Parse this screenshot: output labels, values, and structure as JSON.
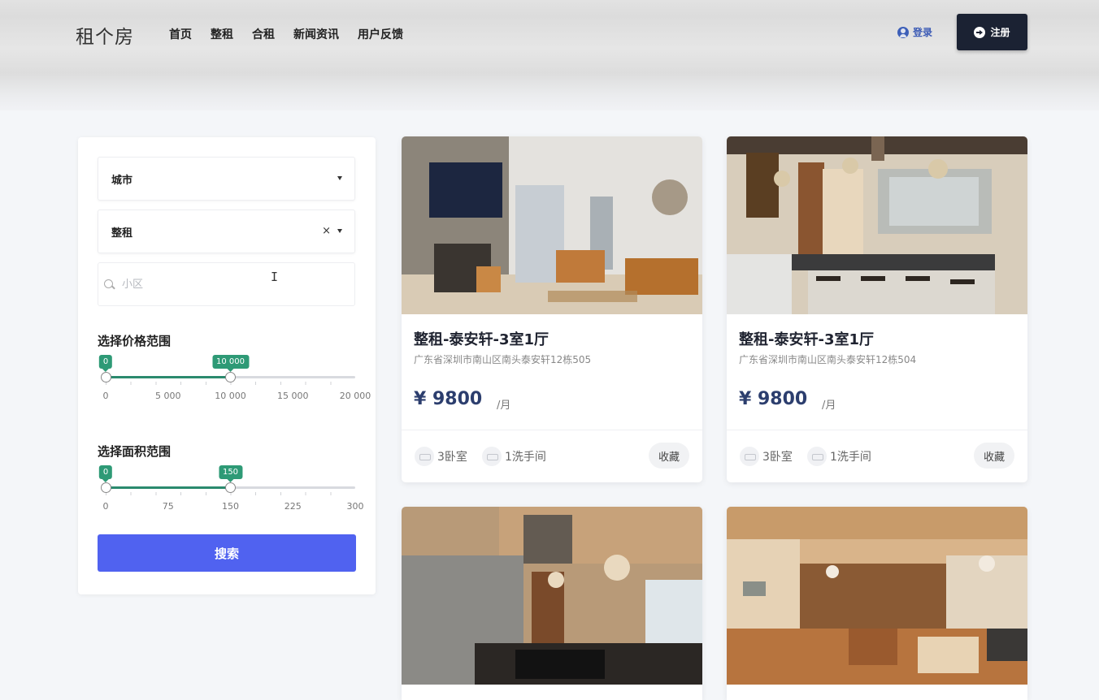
{
  "header": {
    "brand": "租个房",
    "nav": [
      "首页",
      "整租",
      "合租",
      "新闻资讯",
      "用户反馈"
    ],
    "login_label": "登录",
    "register_label": "注册"
  },
  "filter": {
    "city_placeholder": "城市",
    "rent_type_value": "整租",
    "clear_symbol": "×",
    "community_placeholder": "小区",
    "price": {
      "title": "选择价格范围",
      "min_label": "0",
      "max_label": "10 000",
      "min_value": 0,
      "max_value": 10000,
      "scale_max": 20000,
      "ticks": [
        "0",
        "5 000",
        "10 000",
        "15 000",
        "20 000"
      ]
    },
    "area": {
      "title": "选择面积范围",
      "min_label": "0",
      "max_label": "150",
      "min_value": 0,
      "max_value": 150,
      "scale_max": 300,
      "ticks": [
        "0",
        "75",
        "150",
        "225",
        "300"
      ]
    },
    "search_label": "搜索"
  },
  "listings": [
    {
      "title": "整租-泰安轩-3室1厅",
      "address": "广东省深圳市南山区南头泰安轩12栋505",
      "price": "¥ 9800",
      "unit": "/月",
      "bedrooms": "3卧室",
      "bathrooms": "1洗手间",
      "favorite_label": "收藏"
    },
    {
      "title": "整租-泰安轩-3室1厅",
      "address": "广东省深圳市南山区南头泰安轩12栋504",
      "price": "¥ 9800",
      "unit": "/月",
      "bedrooms": "3卧室",
      "bathrooms": "1洗手间",
      "favorite_label": "收藏"
    }
  ],
  "colors": {
    "primary_button": "#5062f0",
    "register_button": "#1b2233",
    "slider_range": "#2b8a6e",
    "price_text": "#2c3e6e"
  }
}
